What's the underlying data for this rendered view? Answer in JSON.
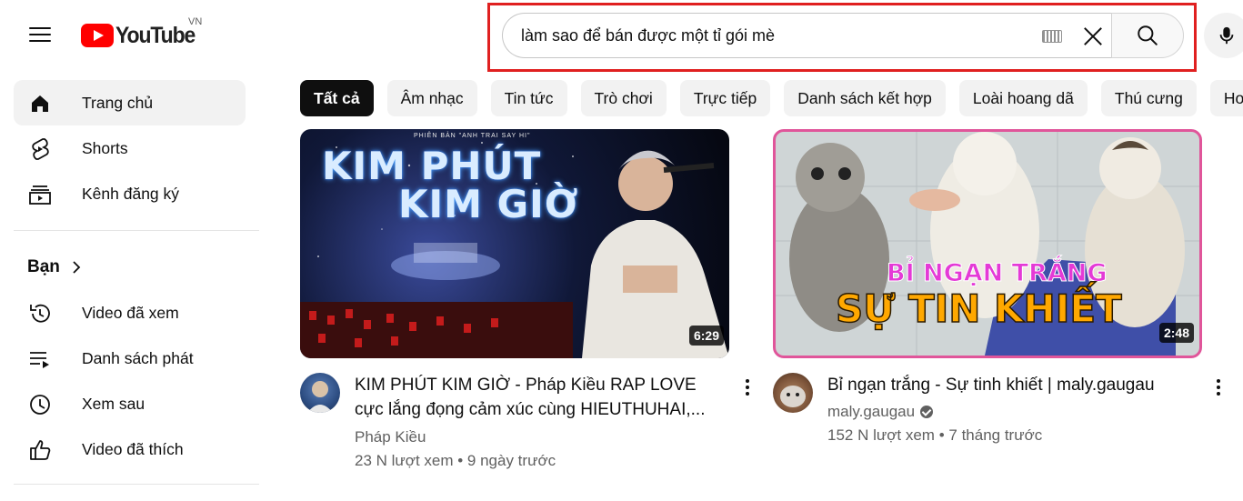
{
  "header": {
    "logo_text": "YouTube",
    "country_code": "VN",
    "search_value": "làm sao để bán được một tỉ gói mè"
  },
  "sidebar": {
    "items": [
      {
        "label": "Trang chủ",
        "icon": "home-icon"
      },
      {
        "label": "Shorts",
        "icon": "shorts-icon"
      },
      {
        "label": "Kênh đăng ký",
        "icon": "subscriptions-icon"
      }
    ],
    "you_section": {
      "label": "Bạn",
      "items": [
        {
          "label": "Video đã xem",
          "icon": "history-icon"
        },
        {
          "label": "Danh sách phát",
          "icon": "playlist-icon"
        },
        {
          "label": "Xem sau",
          "icon": "watch-later-icon"
        },
        {
          "label": "Video đã thích",
          "icon": "thumbs-up-icon"
        }
      ]
    }
  },
  "chips": [
    "Tất cả",
    "Âm nhạc",
    "Tin tức",
    "Trò chơi",
    "Trực tiếp",
    "Danh sách kết hợp",
    "Loài hoang dã",
    "Thú cưng",
    "Hoạ"
  ],
  "videos": [
    {
      "title": "KIM PHÚT KIM GIỜ - Pháp Kiều RAP LOVE cực lắng đọng cảm xúc cùng HIEUTHUHAI,...",
      "thumb_top_text": "PHIÊN BẢN \"ANH TRAI SAY HI\"",
      "thumb_title_1": "KIM PHÚT",
      "thumb_title_2": "KIM GIỜ",
      "duration": "6:29",
      "channel": "Pháp Kiều",
      "verified": false,
      "views": "23 N lượt xem",
      "age": "9 ngày trước"
    },
    {
      "title": "Bỉ ngạn trắng - Sự tinh khiết | maly.gaugau",
      "thumb_title_1": "BỈ NGẠN TRẮNG",
      "thumb_title_2": "SỰ TIN KHIẾT",
      "duration": "2:48",
      "channel": "maly.gaugau",
      "verified": true,
      "views": "152 N lượt xem",
      "age": "7 tháng trước"
    }
  ],
  "colors": {
    "brand_red": "#ff0000",
    "highlight_border": "#e02020",
    "chip_active": "#0f0f0f",
    "chip_bg": "#f2f2f2",
    "secondary_text": "#606060",
    "pink_frame": "#e0559a"
  }
}
